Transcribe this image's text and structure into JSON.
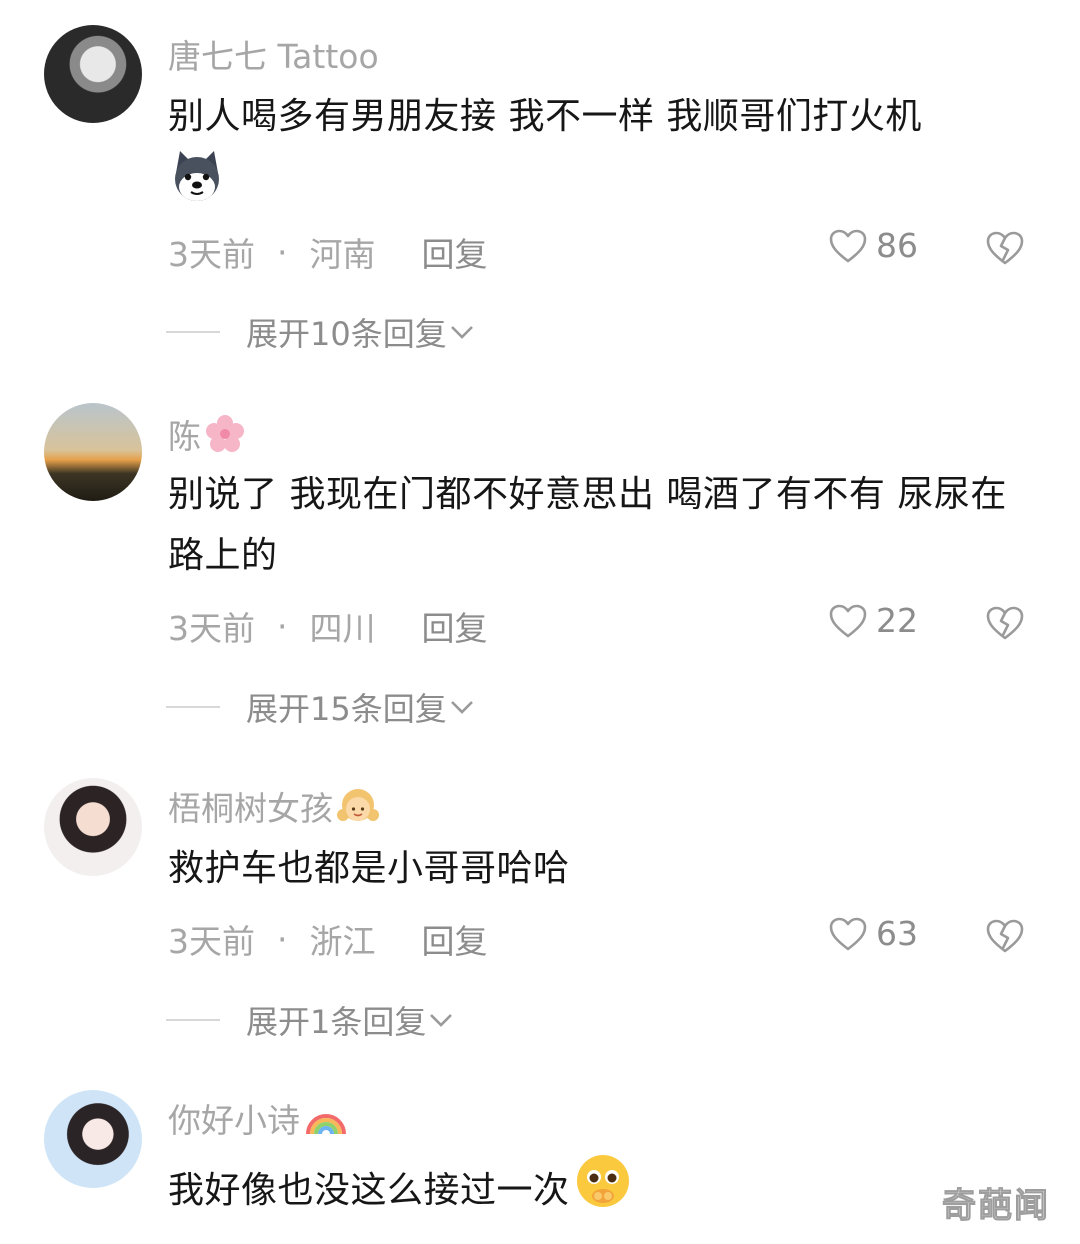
{
  "comments": [
    {
      "username": "唐七七 Tattoo",
      "name_emoji": "",
      "text": "别人喝多有男朋友接 我不一样 我顺哥们打火机",
      "content_emoji": "dog-face-emoji",
      "time": "3天前",
      "location": "河南",
      "reply_label": "回复",
      "likes": "86",
      "expand_label": "展开10条回复"
    },
    {
      "username": "陈",
      "name_emoji": "cherry-blossom-emoji",
      "text": "别说了 我现在门都不好意思出 喝酒了有不有 尿尿在路上的",
      "content_emoji": "",
      "time": "3天前",
      "location": "四川",
      "reply_label": "回复",
      "likes": "22",
      "expand_label": "展开15条回复"
    },
    {
      "username": "梧桐树女孩",
      "name_emoji": "girl-emoji",
      "text": "救护车也都是小哥哥哈哈",
      "content_emoji": "",
      "time": "3天前",
      "location": "浙江",
      "reply_label": "回复",
      "likes": "63",
      "expand_label": "展开1条回复"
    },
    {
      "username": "你好小诗",
      "name_emoji": "rainbow-emoji",
      "text": "我好像也没这么接过一次",
      "content_emoji": "pleading-face-emoji"
    }
  ],
  "meta_separator": "·",
  "watermark": "奇葩闻"
}
